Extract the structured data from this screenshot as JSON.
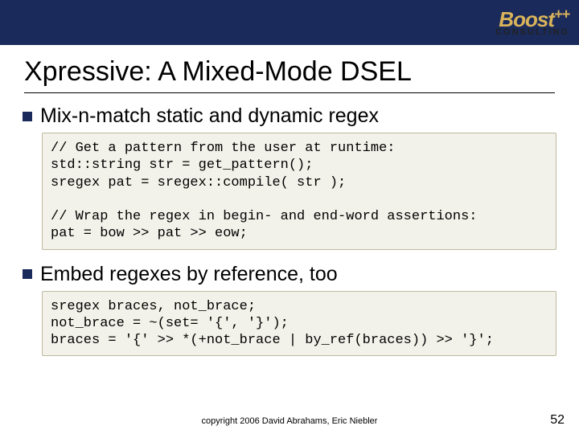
{
  "logo": {
    "main": "Boost",
    "plus": "++",
    "sub": "CONSULTING"
  },
  "title": "Xpressive: A Mixed-Mode DSEL",
  "bullets": [
    {
      "text": "Mix-n-match static and dynamic regex"
    },
    {
      "text": "Embed regexes by reference, too"
    }
  ],
  "code_blocks": [
    "// Get a pattern from the user at runtime:\nstd::string str = get_pattern();\nsregex pat = sregex::compile( str );\n\n// Wrap the regex in begin- and end-word assertions:\npat = bow >> pat >> eow;",
    "sregex braces, not_brace;\nnot_brace = ~(set= '{', '}');\nbraces = '{' >> *(+not_brace | by_ref(braces)) >> '}';"
  ],
  "footer": "copyright 2006 David Abrahams, Eric Niebler",
  "page_number": "52"
}
